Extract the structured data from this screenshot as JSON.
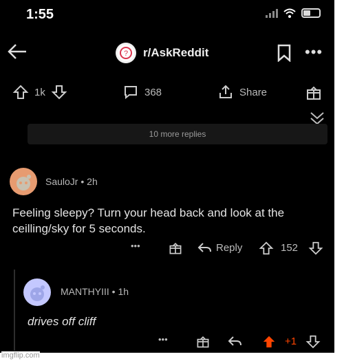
{
  "status": {
    "time": "1:55"
  },
  "header": {
    "subreddit": "r/AskReddit"
  },
  "post_actions": {
    "upvotes": "1k",
    "comments": "368",
    "share_label": "Share"
  },
  "thread": {
    "more_replies_label": "10 more replies",
    "comment1": {
      "author": "SauloJr",
      "age": "2h",
      "text": "Feeling sleepy? Turn your head back and look at the ceilling/sky for 5 seconds.",
      "reply_label": "Reply",
      "score": "152"
    },
    "comment2": {
      "author": "MANTHYIII",
      "age": "1h",
      "text": "drives off cliff",
      "score": "+1"
    }
  },
  "watermark": "imgflip.com",
  "colors": {
    "background": "#000000",
    "upvote_active": "#ff4500",
    "avatar1": "#e79b70",
    "avatar2": "#c4c8ff"
  }
}
